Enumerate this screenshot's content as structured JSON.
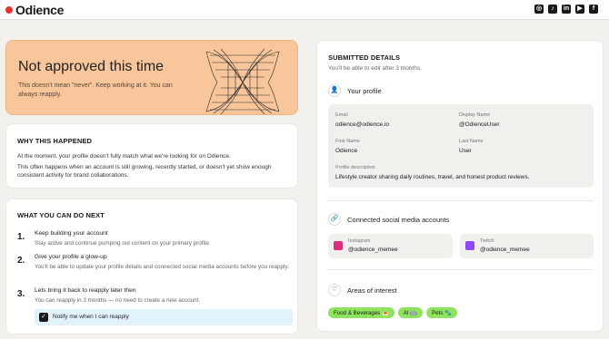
{
  "brand": {
    "name": "Odience",
    "accent": "#e5352a"
  },
  "socials": [
    {
      "icon": "instagram-icon",
      "glyph": "◎"
    },
    {
      "icon": "tiktok-icon",
      "glyph": "♪"
    },
    {
      "icon": "linkedin-icon",
      "glyph": "in"
    },
    {
      "icon": "youtube-icon",
      "glyph": "▶"
    },
    {
      "icon": "facebook-icon",
      "glyph": "f"
    }
  ],
  "banner": {
    "title": "Not approved this time",
    "text": "This doesn't mean \"never\". Keep working at it. You can always reapply.",
    "color": "#f8c69a"
  },
  "why": {
    "title": "Why this happened",
    "p1": "At the moment, your profile doesn't fully match what we're looking for on Odience.",
    "p2": "This often happens when an account is still growing, recently started, or doesn't yet show enough consistent activity for brand collaborations."
  },
  "next": {
    "title": "What you can do next",
    "steps": [
      {
        "num": "1.",
        "title": "Keep building your account",
        "desc": "Stay active and continue pumping out content on your primary profile."
      },
      {
        "num": "2.",
        "title": "Give your profile a glow-up",
        "desc": "You'll be able to update your profile details and connected social media accounts before you reapply."
      },
      {
        "num": "3.",
        "title": "Lets bring it back to reapply later then",
        "desc": "You can reapply in 3 months — no need to create a new account."
      }
    ],
    "notify_label": "Notify me when I can reapply",
    "notify_checked": true
  },
  "details": {
    "title": "Submitted details",
    "subtitle": "You'll be able to edit after 3 months.",
    "profile_heading": "Your profile",
    "fields": {
      "email_label": "Email",
      "email": "odience@odience.io",
      "display_label": "Display Name",
      "display": "@OdienceUser",
      "first_label": "First Name",
      "first": "Odience",
      "last_label": "Last Name",
      "last": "User",
      "desc_label": "Profile description",
      "desc": "Lifestyle creator sharing daily routines, travel, and honest product reviews."
    },
    "social_heading": "Connected social media accounts",
    "accounts": [
      {
        "platform": "Instagram",
        "handle": "@odience_memee",
        "color": "#d6307d"
      },
      {
        "platform": "Twitch",
        "handle": "@odience_memee",
        "color": "#9146ff"
      }
    ],
    "interests_heading": "Areas of interest",
    "interests": [
      "Food & Beverages 🍝",
      "AI 🤖",
      "Pets 🐾"
    ]
  }
}
